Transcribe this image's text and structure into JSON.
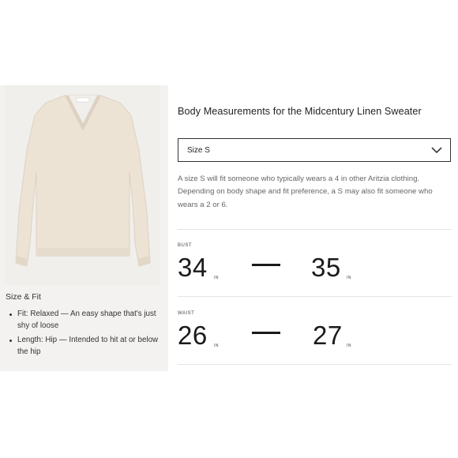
{
  "heading": "Body Measurements for the Midcentury Linen Sweater",
  "size_select": {
    "selected": "Size S"
  },
  "fit_note": "A size S will fit someone who typically wears a 4 in other Aritzia clothing. Depending on body shape and fit preference, a S may also fit someone who wears a 2 or 6.",
  "size_fit": {
    "title": "Size & Fit",
    "items": [
      "Fit: Relaxed — An easy shape that's just shy of loose",
      "Length: Hip — Intended to hit at or below the hip"
    ]
  },
  "measurements": [
    {
      "label": "BUST",
      "min": "34",
      "max": "35",
      "unit": "IN"
    },
    {
      "label": "WAIST",
      "min": "26",
      "max": "27",
      "unit": "IN"
    }
  ],
  "colors": {
    "sweater": "#ece3d5",
    "panel": "#f3f2f0",
    "border": "#333333"
  }
}
